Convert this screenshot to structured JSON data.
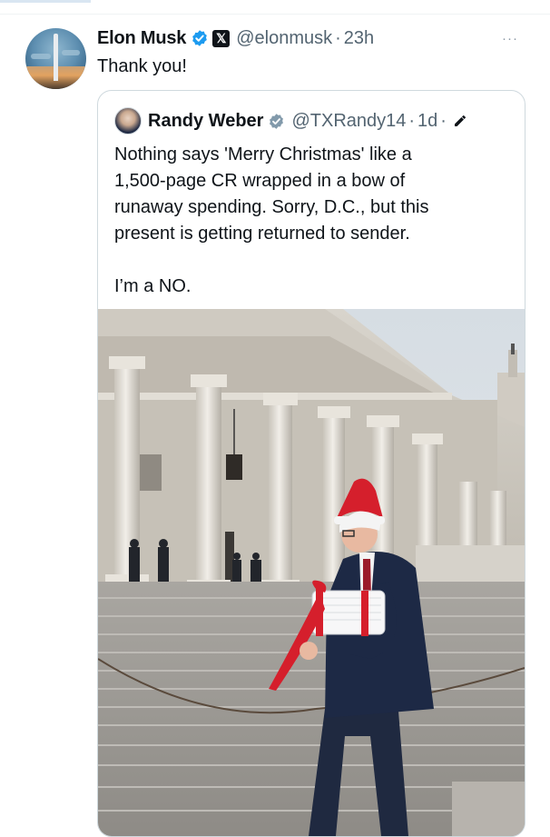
{
  "tweet": {
    "author_name": "Elon Musk",
    "handle": "@elonmusk",
    "separator": "·",
    "time": "23h",
    "platform_badge": "𝕏",
    "more_label": "···",
    "text": "Thank you!",
    "icons": {
      "verified": "verified-badge-icon",
      "more": "more-options-icon",
      "platform": "x-logo-icon"
    }
  },
  "quoted_tweet": {
    "author_name": "Randy Weber",
    "handle": "@TXRandy14",
    "separator": "·",
    "time": "1d",
    "trailing_separator": "·",
    "text_lines": [
      "Nothing says 'Merry Christmas' like a",
      "1,500-page CR wrapped in a bow of",
      "runaway spending. Sorry, D.C., but this",
      "present is getting returned to sender."
    ],
    "closing": "I’m a NO.",
    "icons": {
      "verified": "verified-badge-icon",
      "edited": "edit-pencil-icon"
    },
    "media": "photo of man carrying a wrapped stack of paper on capitol steps"
  },
  "colors": {
    "verified_blue": "#1d9bf0",
    "secondary_text": "#536471",
    "border": "#cfd9de",
    "ribbon_red": "#d51f2c"
  }
}
